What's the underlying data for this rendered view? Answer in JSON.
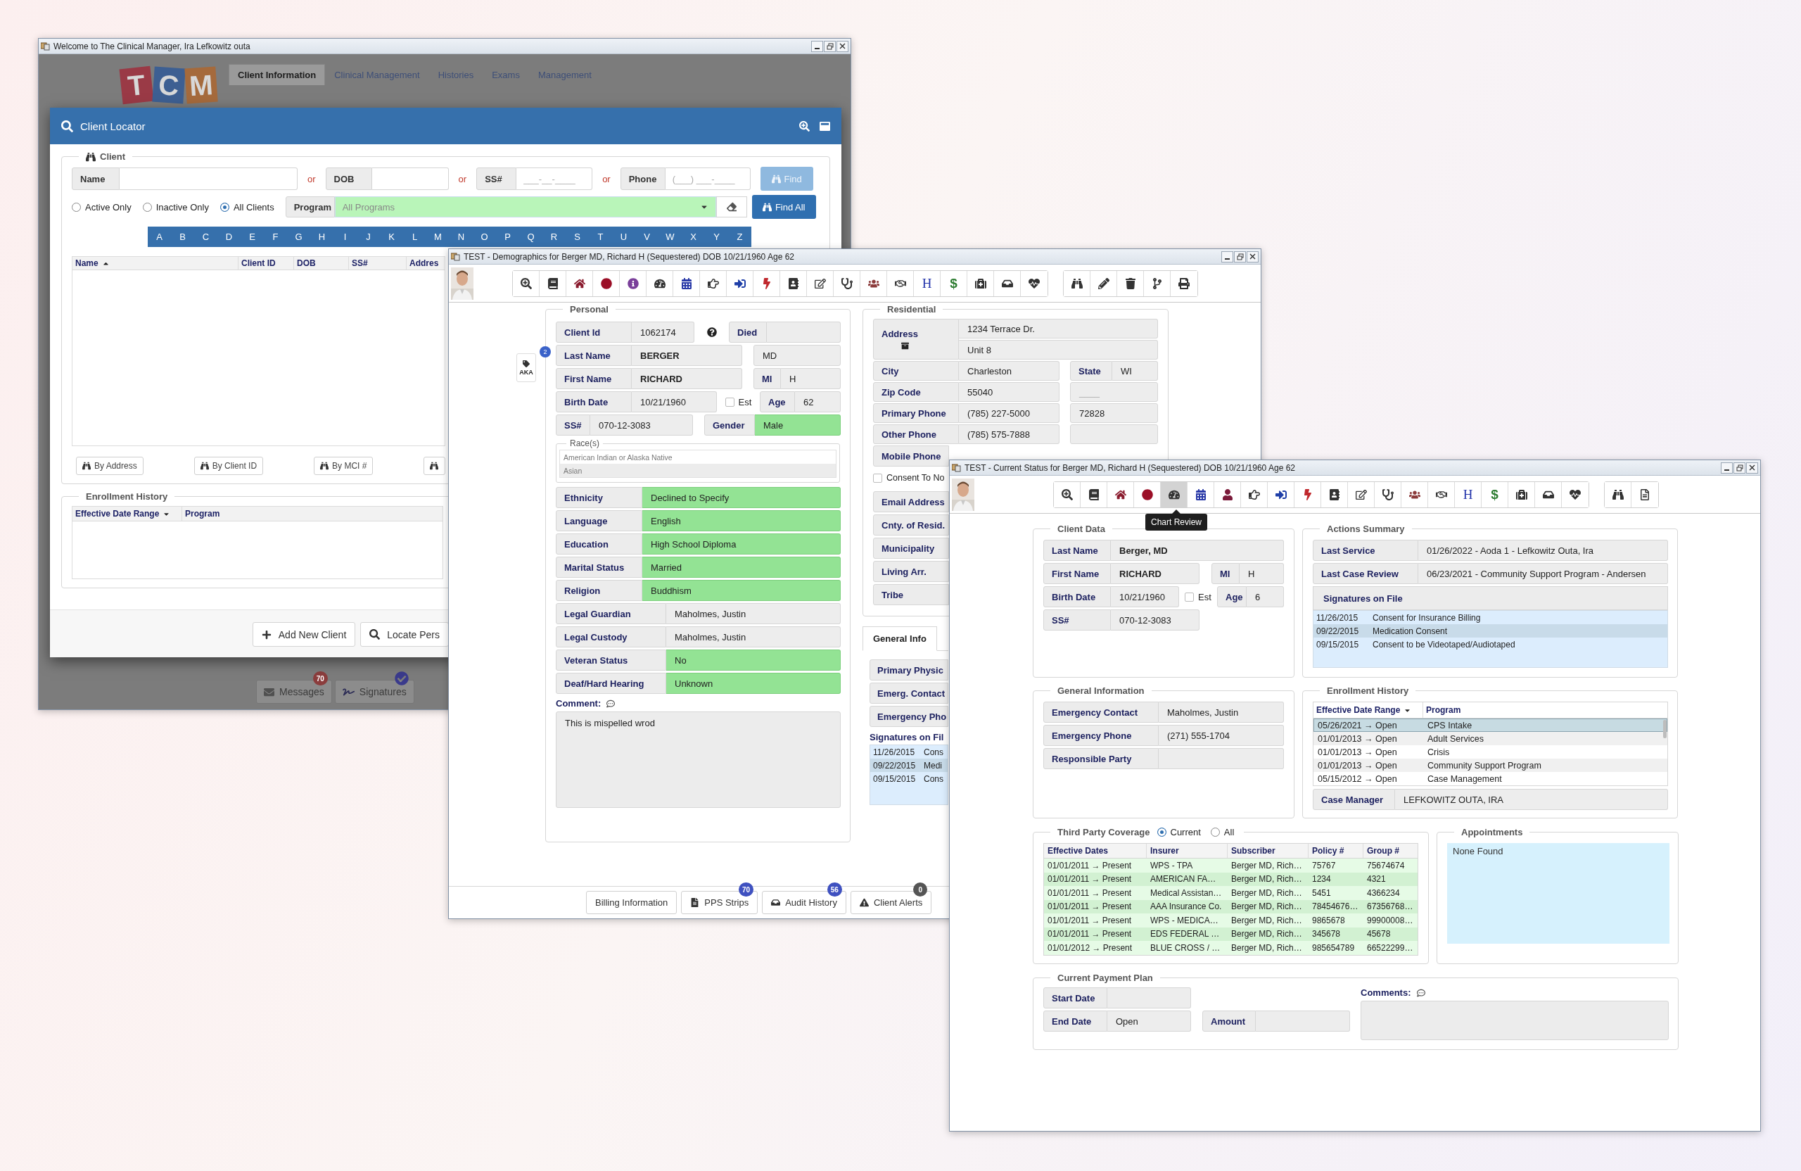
{
  "main_window": {
    "title": "Welcome to The Clinical Manager, Ira Lefkowitz outa",
    "logo": [
      "T",
      "C",
      "M"
    ],
    "tabs": [
      {
        "label": "Client Information",
        "selected": true
      },
      {
        "label": "Clinical Management",
        "selected": false
      },
      {
        "label": "Histories",
        "selected": false
      },
      {
        "label": "Exams",
        "selected": false
      },
      {
        "label": "Management",
        "selected": false
      }
    ],
    "taskbar": [
      {
        "kind": "messages",
        "label": "Messages",
        "badge": "70"
      },
      {
        "kind": "signatures",
        "label": "Signatures"
      }
    ],
    "client_locator": {
      "title": "Client Locator",
      "legend": "Client",
      "search_fields": [
        {
          "label": "Name"
        },
        {
          "label": "DOB"
        },
        {
          "label": "SS#",
          "placeholder": "___-__-____"
        },
        {
          "label": "Phone",
          "placeholder": "(___) ___-____"
        }
      ],
      "separators": [
        "or",
        "or",
        "or"
      ],
      "find_button": {
        "label": "Find",
        "disabled": true
      },
      "status_filters": [
        {
          "label": "Active Only",
          "selected": false
        },
        {
          "label": "Inactive Only",
          "selected": false
        },
        {
          "label": "All Clients",
          "selected": true
        }
      ],
      "program": {
        "label": "Program",
        "placeholder": "All Programs"
      },
      "find_all_button": {
        "label": "Find All",
        "disabled": false
      },
      "letters": [
        "A",
        "B",
        "C",
        "D",
        "E",
        "F",
        "G",
        "H",
        "I",
        "J",
        "K",
        "L",
        "M",
        "N",
        "O",
        "P",
        "Q",
        "R",
        "S",
        "T",
        "U",
        "V",
        "W",
        "X",
        "Y",
        "Z"
      ],
      "columns": [
        {
          "label": "Name",
          "sort_up": true,
          "sort_down": false
        },
        {
          "label": "Client ID",
          "sort_up": false,
          "sort_down": false
        },
        {
          "label": "DOB",
          "sort_up": false,
          "sort_down": false
        },
        {
          "label": "SS#",
          "sort_up": false,
          "sort_down": false
        },
        {
          "label": "Addres",
          "sort_up": false,
          "sort_down": false
        }
      ],
      "search_buttons": [
        "By Address",
        "By Client ID",
        "By MCI #"
      ],
      "enrollment_history": {
        "legend": "Enrollment History",
        "columns": [
          {
            "label": "Effective Date Range",
            "sort_up": false,
            "sort_down": true
          },
          {
            "label": "Program",
            "sort_up": false,
            "sort_down": false
          }
        ]
      },
      "footer_buttons": [
        {
          "kind": "add",
          "label": "Add New Client"
        },
        {
          "kind": "locate",
          "label": "Locate Pers"
        }
      ]
    }
  },
  "demographics_window": {
    "title": "TEST - Demographics for Berger MD, Richard H (Sequestered) DOB 10/21/1960 Age 62",
    "toolbar": [
      [
        {
          "kind": "zoom",
          "selected": false
        },
        {
          "kind": "book",
          "selected": false
        },
        {
          "kind": "home",
          "selected": false
        },
        {
          "kind": "record",
          "selected": false
        },
        {
          "kind": "info",
          "selected": false
        },
        {
          "kind": "gauge",
          "selected": false
        },
        {
          "kind": "calendar",
          "selected": false
        },
        {
          "kind": "hand",
          "selected": false
        },
        {
          "kind": "signin",
          "selected": false
        },
        {
          "kind": "bolt",
          "selected": false
        },
        {
          "kind": "binder",
          "selected": false
        },
        {
          "kind": "edit",
          "selected": false
        },
        {
          "kind": "stethoscope",
          "selected": false
        },
        {
          "kind": "group",
          "selected": false
        },
        {
          "kind": "handshake",
          "selected": false
        },
        {
          "kind": "letter",
          "glyph": "H",
          "selected": false
        },
        {
          "kind": "currency",
          "glyph": "$",
          "selected": false
        },
        {
          "kind": "medkit",
          "selected": false
        },
        {
          "kind": "inbox",
          "selected": false
        },
        {
          "kind": "heartbeat",
          "selected": false
        }
      ],
      [
        {
          "kind": "binoculars",
          "selected": false
        },
        {
          "kind": "pencil",
          "selected": false
        },
        {
          "kind": "trash",
          "selected": false
        },
        {
          "kind": "branch",
          "selected": false
        },
        {
          "kind": "print",
          "selected": false
        }
      ]
    ],
    "aka": {
      "label": "AKA",
      "badge": "2"
    },
    "personal": {
      "legend": "Personal",
      "client_id": {
        "label": "Client Id",
        "value": "1062174"
      },
      "died": {
        "label": "Died"
      },
      "last_name": {
        "label": "Last Name",
        "value": "BERGER"
      },
      "suffix": {
        "value": "MD"
      },
      "first_name": {
        "label": "First Name",
        "value": "RICHARD"
      },
      "mi": {
        "label": "MI",
        "value": "H"
      },
      "birth_date": {
        "label": "Birth Date",
        "value": "10/21/1960"
      },
      "estimated": {
        "label": "Est",
        "checked": false
      },
      "age": {
        "label": "Age",
        "value": "62"
      },
      "ssn": {
        "label": "SS#",
        "value": "070-12-3083"
      },
      "gender": {
        "label": "Gender",
        "value": "Male",
        "highlighted": true
      },
      "races": {
        "legend": "Race(s)",
        "items": [
          {
            "label": "American Indian or Alaska Native",
            "selected": false
          },
          {
            "label": "Asian",
            "selected": true
          }
        ]
      },
      "background": [
        {
          "label": "Ethnicity",
          "value": "Declined to Specify",
          "highlighted": true
        },
        {
          "label": "Language",
          "value": "English",
          "highlighted": true
        },
        {
          "label": "Education",
          "value": "High School Diploma",
          "highlighted": true
        },
        {
          "label": "Marital Status",
          "value": "Married",
          "highlighted": true
        },
        {
          "label": "Religion",
          "value": "Buddhism",
          "highlighted": true
        }
      ],
      "legal": [
        {
          "label": "Legal Guardian",
          "value": "Maholmes, Justin",
          "highlighted": false
        },
        {
          "label": "Legal Custody",
          "value": "Maholmes, Justin",
          "highlighted": false
        },
        {
          "label": "Veteran Status",
          "value": "No",
          "highlighted": true
        },
        {
          "label": "Deaf/Hard Hearing",
          "value": "Unknown",
          "highlighted": true
        }
      ],
      "comment": {
        "label": "Comment:",
        "value": "This is mispelled wrod"
      }
    },
    "residential": {
      "legend": "Residential",
      "address": {
        "label": "Address",
        "lines": [
          "1234 Terrace Dr.",
          "Unit 8"
        ]
      },
      "city": {
        "label": "City",
        "value": "Charleston"
      },
      "state": {
        "label": "State",
        "value": "WI"
      },
      "zip": {
        "label": "Zip Code",
        "value": "55040",
        "extra_placeholder": "____"
      },
      "primary_phone": {
        "label": "Primary Phone",
        "value": "(785) 227-5000",
        "extension": "72828"
      },
      "other_phone": {
        "label": "Other Phone",
        "value": "(785) 575-7888"
      },
      "mobile_phone": {
        "label": "Mobile Phone"
      },
      "consent": {
        "label": "Consent To No",
        "checked": false
      },
      "more_fields": [
        "Email Address",
        "Cnty. of Resid.",
        "Municipality",
        "Living Arr.",
        "Tribe"
      ]
    },
    "info_tabs": [
      {
        "label": "General Info",
        "selected": true
      }
    ],
    "general_info": {
      "fields": [
        "Primary Physic",
        "Emerg. Contact",
        "Emergency Pho"
      ],
      "signatures_title": "Signatures on Fil",
      "signatures": [
        {
          "date": "11/26/2015",
          "name": "Cons",
          "selected": false
        },
        {
          "date": "09/22/2015",
          "name": "Medi",
          "selected": true
        },
        {
          "date": "09/15/2015",
          "name": "Cons",
          "selected": false
        }
      ]
    },
    "bottom_buttons": [
      {
        "kind": "plain",
        "label": "Billing Information"
      },
      {
        "kind": "document",
        "label": "PPS Strips",
        "badge": "70",
        "color": "#3f51c0"
      },
      {
        "kind": "inbox",
        "label": "Audit History",
        "badge": "56",
        "color": "#3f51c0"
      },
      {
        "kind": "alert",
        "label": "Client Alerts",
        "badge": "0",
        "color": "#555555"
      }
    ]
  },
  "status_window": {
    "title": "TEST - Current Status for Berger MD, Richard H (Sequestered) DOB 10/21/1960 Age 62",
    "toolbar": [
      [
        {
          "kind": "zoom",
          "selected": false
        },
        {
          "kind": "book",
          "selected": false
        },
        {
          "kind": "home",
          "selected": false
        },
        {
          "kind": "record",
          "selected": false
        },
        {
          "kind": "gauge",
          "selected": true
        },
        {
          "kind": "calendar",
          "selected": false
        },
        {
          "kind": "person",
          "selected": false
        },
        {
          "kind": "hand",
          "selected": false
        },
        {
          "kind": "signin",
          "selected": false
        },
        {
          "kind": "bolt",
          "selected": false
        },
        {
          "kind": "binder",
          "selected": false
        },
        {
          "kind": "edit",
          "selected": false
        },
        {
          "kind": "stethoscope",
          "selected": false
        },
        {
          "kind": "group",
          "selected": false
        },
        {
          "kind": "handshake",
          "selected": false
        },
        {
          "kind": "letter",
          "glyph": "H",
          "selected": false
        },
        {
          "kind": "currency",
          "glyph": "$",
          "selected": false
        },
        {
          "kind": "medkit",
          "selected": false
        },
        {
          "kind": "inbox",
          "selected": false
        },
        {
          "kind": "heartbeat",
          "selected": false
        }
      ],
      [
        {
          "kind": "binoculars",
          "selected": false
        },
        {
          "kind": "document",
          "selected": false
        }
      ]
    ],
    "tooltip": "Chart Review",
    "client_data": {
      "legend": "Client Data",
      "last_name": {
        "label": "Last Name",
        "value": "Berger, MD"
      },
      "first_name": {
        "label": "First Name",
        "value": "RICHARD"
      },
      "mi": {
        "label": "MI",
        "value": "H"
      },
      "birth_date": {
        "label": "Birth Date",
        "value": "10/21/1960"
      },
      "estimated": {
        "label": "Est",
        "checked": false
      },
      "age": {
        "label": "Age",
        "value": "6"
      },
      "ssn": {
        "label": "SS#",
        "value": "070-12-3083"
      }
    },
    "actions_summary": {
      "legend": "Actions Summary",
      "fields": [
        {
          "label": "Last Service",
          "value": "01/26/2022 - Aoda 1 - Lefkowitz Outa, Ira"
        },
        {
          "label": "Last Case Review",
          "value": "06/23/2021 - Community Support Program - Andersen"
        }
      ],
      "signatures_title": "Signatures on File",
      "signatures": [
        {
          "date": "11/26/2015",
          "name": "Consent for Insurance Billing",
          "selected": false
        },
        {
          "date": "09/22/2015",
          "name": "Medication Consent",
          "selected": true
        },
        {
          "date": "09/15/2015",
          "name": "Consent to be Videotaped/Audiotaped",
          "selected": false
        }
      ]
    },
    "general_information": {
      "legend": "General Information",
      "fields": [
        {
          "label": "Emergency Contact",
          "value": "Maholmes, Justin"
        },
        {
          "label": "Emergency Phone",
          "value": "(271) 555-1704"
        },
        {
          "label": "Responsible Party"
        }
      ]
    },
    "enrollment_history": {
      "legend": "Enrollment History",
      "columns": [
        {
          "label": "Effective Date Range",
          "sort_up": false,
          "sort_down": true
        },
        {
          "label": "Program",
          "sort_up": false,
          "sort_down": false
        }
      ],
      "rows": [
        {
          "dates": "05/26/2021 → Open",
          "program": "CPS Intake",
          "selected": true
        },
        {
          "dates": "01/01/2013 → Open",
          "program": "Adult Services",
          "selected": false
        },
        {
          "dates": "01/01/2013 → Open",
          "program": "Crisis",
          "selected": false
        },
        {
          "dates": "01/01/2013 → Open",
          "program": "Community Support Program",
          "selected": false
        },
        {
          "dates": "05/15/2012 → Open",
          "program": "Case Management",
          "selected": false
        }
      ],
      "case_manager": {
        "label": "Case Manager",
        "value": "LEFKOWITZ OUTA, IRA"
      }
    },
    "third_party_coverage": {
      "legend": "Third Party Coverage",
      "filters": [
        {
          "label": "Current",
          "selected": true
        },
        {
          "label": "All",
          "selected": false
        }
      ],
      "columns": [
        "Effective Dates",
        "Insurer",
        "Subscriber",
        "Policy #",
        "Group #"
      ],
      "rows": [
        [
          "01/01/2011 → Present",
          "WPS - TPA",
          "Berger MD, Rich…",
          "75767",
          "75674674"
        ],
        [
          "01/01/2011 → Present",
          "AMERICAN FA…",
          "Berger MD, Rich…",
          "1234",
          "4321"
        ],
        [
          "01/01/2011 → Present",
          "Medical Assistan…",
          "Berger MD, Rich…",
          "5451",
          "4366234"
        ],
        [
          "01/01/2011 → Present",
          "AAA Insurance Co.",
          "Berger MD, Rich…",
          "78454676…",
          "67356768…"
        ],
        [
          "01/01/2011 → Present",
          "WPS - MEDICA…",
          "Berger MD, Rich…",
          "9865678",
          "99900008…"
        ],
        [
          "01/01/2011 → Present",
          "EDS FEDERAL …",
          "Berger MD, Rich…",
          "345678",
          "45678"
        ],
        [
          "01/01/2012 → Present",
          "BLUE CROSS / …",
          "Berger MD, Rich…",
          "985654789",
          "66522299…"
        ]
      ]
    },
    "appointments": {
      "legend": "Appointments",
      "empty_text": "None Found"
    },
    "payment_plan": {
      "legend": "Current Payment Plan",
      "start_date": {
        "label": "Start Date"
      },
      "end_date": {
        "label": "End Date",
        "value": "Open"
      },
      "amount": {
        "label": "Amount"
      },
      "comments_label": "Comments:"
    }
  }
}
